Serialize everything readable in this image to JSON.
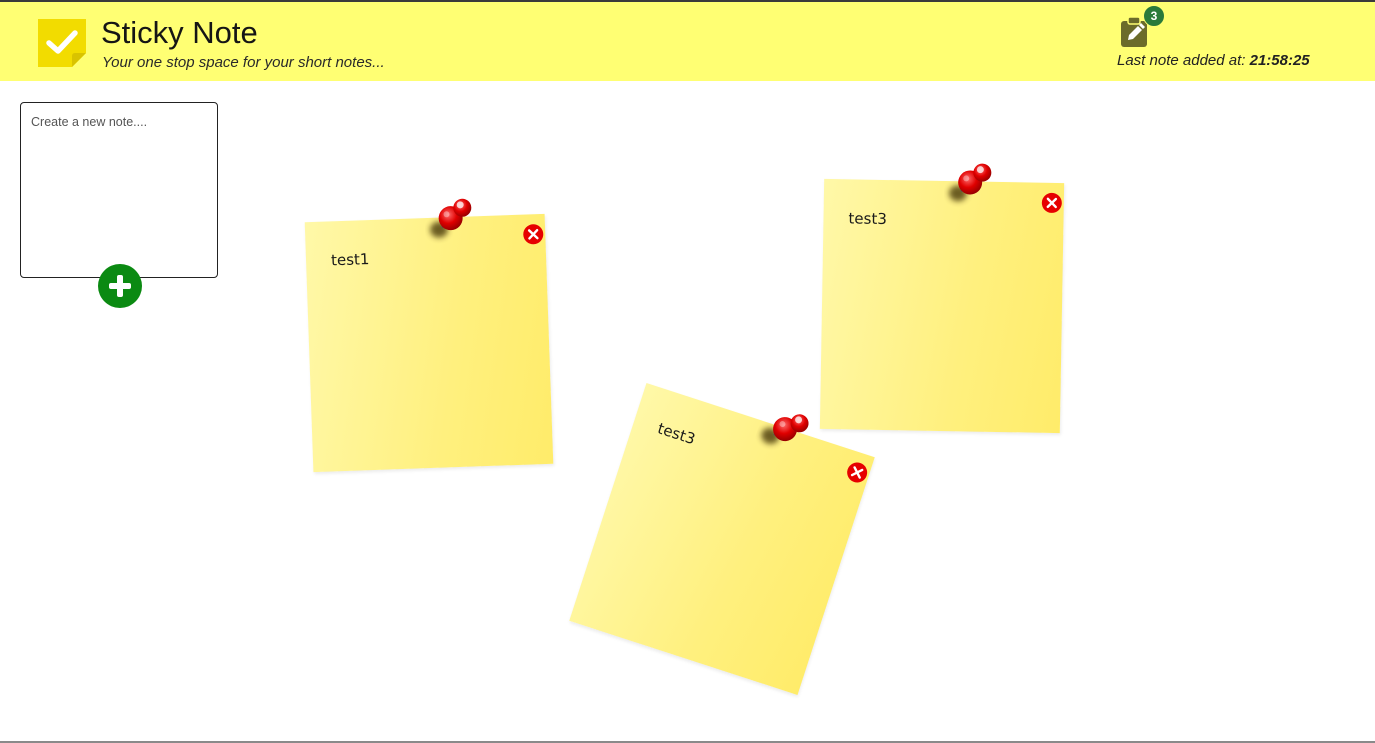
{
  "header": {
    "title": "Sticky Note",
    "subtitle": "Your one stop space for your short notes...",
    "logo_icon": "checkmark-note-icon",
    "notes_icon": "clipboard-edit-icon",
    "notes_count": "3",
    "last_added_label": "Last note added at:",
    "last_added_time": "21:58:25"
  },
  "composer": {
    "placeholder": "Create a new note....",
    "value": "",
    "add_icon": "plus-icon"
  },
  "notes": [
    {
      "text": "test1",
      "pin_icon": "pushpin-icon",
      "delete_icon": "close-icon"
    },
    {
      "text": "test3",
      "pin_icon": "pushpin-icon",
      "delete_icon": "close-icon"
    },
    {
      "text": "test3",
      "pin_icon": "pushpin-icon",
      "delete_icon": "close-icon"
    }
  ],
  "colors": {
    "header_bg": "#ffff73",
    "logo_yellow": "#f2dc00",
    "add_button": "#0b8a12",
    "delete_button": "#e60000",
    "pin_red": "#e00000",
    "badge_green": "#2a7a3a",
    "note_yellow": "#fff07e"
  }
}
